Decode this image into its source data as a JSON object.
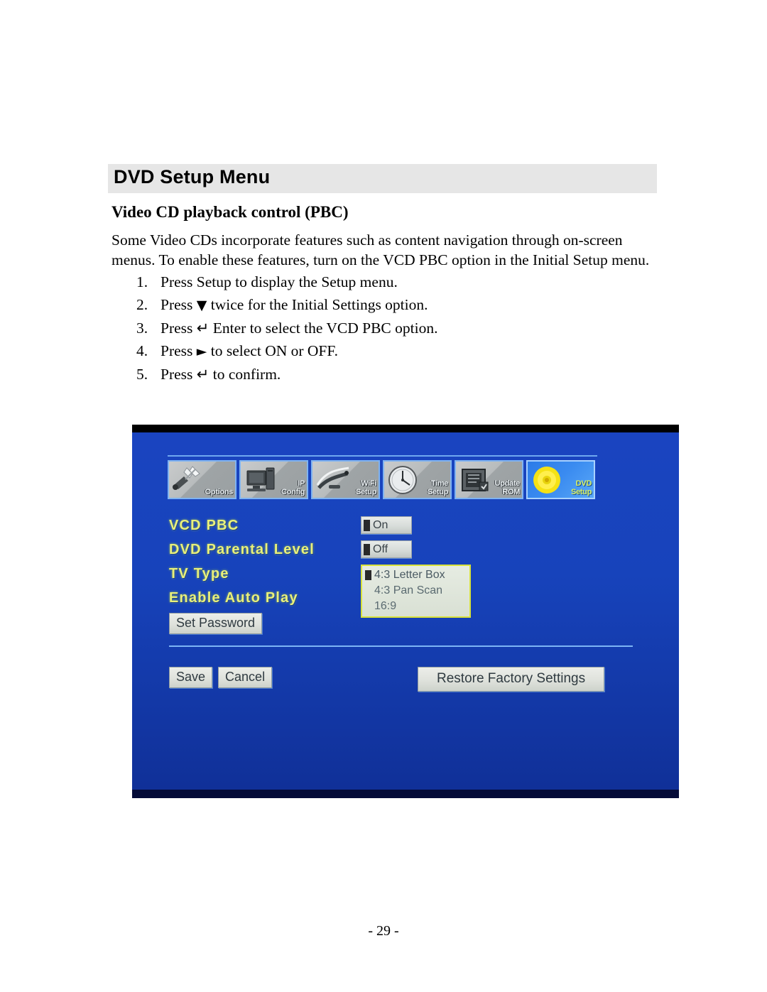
{
  "document": {
    "title": "DVD Setup Menu",
    "subhead": "Video CD playback control (PBC)",
    "paragraph": "Some Video CDs incorporate features such as content navigation through on-screen menus. To enable these features, turn on the VCD PBC option in the Initial Setup menu.",
    "steps": [
      {
        "num": "1.",
        "pre": "Press Setup to display the Setup menu.",
        "glyph": "",
        "post": ""
      },
      {
        "num": "2.",
        "pre": "Press ",
        "glyph": "▼",
        "post": " twice for the Initial Settings option."
      },
      {
        "num": "3.",
        "pre": "Press ",
        "glyph": "↵",
        "post": " Enter to select the VCD PBC option."
      },
      {
        "num": "4.",
        "pre": "Press ",
        "glyph": "►",
        "post": " to select ON or OFF."
      },
      {
        "num": "5.",
        "pre": "Press ",
        "glyph": "↵",
        "post": " to confirm."
      }
    ],
    "page_number": "- 29 -"
  },
  "screenshot": {
    "toolbar": [
      {
        "label_line1": "",
        "label_line2": "Options",
        "icon": "options-tools-icon",
        "selected": false
      },
      {
        "label_line1": "IP",
        "label_line2": "Config",
        "icon": "computer-icon",
        "selected": false
      },
      {
        "label_line1": "WiFi",
        "label_line2": "Setup",
        "icon": "antenna-icon",
        "selected": false
      },
      {
        "label_line1": "Time",
        "label_line2": "Setup",
        "icon": "clock-icon",
        "selected": false
      },
      {
        "label_line1": "Update",
        "label_line2": "ROM",
        "icon": "chip-icon",
        "selected": false
      },
      {
        "label_line1": "DVD",
        "label_line2": "Setup",
        "icon": "disc-icon",
        "selected": true
      }
    ],
    "rows": [
      {
        "label": "VCD PBC",
        "control": "toggle",
        "value": "On"
      },
      {
        "label": "DVD Parental Level",
        "control": "toggle",
        "value": "Off"
      },
      {
        "label": "TV Type",
        "control": "dropdown",
        "value": "4:3 Letter Box",
        "options": [
          "4:3 Letter Box",
          "4:3 Pan Scan",
          "16:9"
        ]
      },
      {
        "label": "Enable Auto Play",
        "control": "none",
        "value": ""
      }
    ],
    "set_password_label": "Set Password",
    "save_label": "Save",
    "cancel_label": "Cancel",
    "restore_label": "Restore Factory Settings",
    "colors": {
      "background_blue": "#1437a8",
      "label_yellow": "#e9f07a",
      "dropdown_border": "#d8e23a",
      "divider": "#7db4f5"
    }
  }
}
